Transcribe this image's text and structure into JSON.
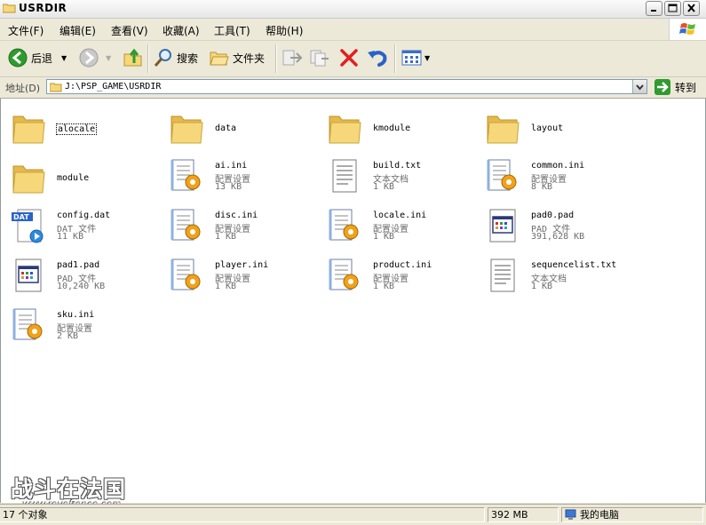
{
  "window": {
    "title": "USRDIR"
  },
  "menu": {
    "items": [
      "文件(F)",
      "编辑(E)",
      "查看(V)",
      "收藏(A)",
      "工具(T)",
      "帮助(H)"
    ]
  },
  "toolbar": {
    "back_label": "后退",
    "search_label": "搜索",
    "folders_label": "文件夹"
  },
  "address": {
    "label": "地址(D)",
    "value": "J:\\PSP_GAME\\USRDIR",
    "go_label": "转到"
  },
  "files": [
    {
      "name": "alocale",
      "kind": "folder",
      "icon": "folder-icon"
    },
    {
      "name": "data",
      "kind": "folder",
      "icon": "folder-icon"
    },
    {
      "name": "kmodule",
      "kind": "folder",
      "icon": "folder-icon"
    },
    {
      "name": "layout",
      "kind": "folder",
      "icon": "folder-icon"
    },
    {
      "name": "module",
      "kind": "folder",
      "icon": "folder-icon"
    },
    {
      "name": "ai.ini",
      "type": "配置设置",
      "size": "13 KB",
      "icon": "ini-file-icon"
    },
    {
      "name": "build.txt",
      "type": "文本文档",
      "size": "1 KB",
      "icon": "text-file-icon"
    },
    {
      "name": "common.ini",
      "type": "配置设置",
      "size": "8 KB",
      "icon": "ini-file-icon"
    },
    {
      "name": "config.dat",
      "type": "DAT 文件",
      "size": "11 KB",
      "icon": "dat-file-icon"
    },
    {
      "name": "disc.ini",
      "type": "配置设置",
      "size": "1 KB",
      "icon": "ini-file-icon"
    },
    {
      "name": "locale.ini",
      "type": "配置设置",
      "size": "1 KB",
      "icon": "ini-file-icon"
    },
    {
      "name": "pad0.pad",
      "type": "PAD 文件",
      "size": "391,628 KB",
      "icon": "pad-file-icon"
    },
    {
      "name": "pad1.pad",
      "type": "PAD 文件",
      "size": "10,240 KB",
      "icon": "pad-file-icon"
    },
    {
      "name": "player.ini",
      "type": "配置设置",
      "size": "1 KB",
      "icon": "ini-file-icon"
    },
    {
      "name": "product.ini",
      "type": "配置设置",
      "size": "1 KB",
      "icon": "ini-file-icon"
    },
    {
      "name": "sequencelist.txt",
      "type": "文本文档",
      "size": "1 KB",
      "icon": "text-file-icon"
    },
    {
      "name": "sku.ini",
      "type": "配置设置",
      "size": "2 KB",
      "icon": "ini-file-icon"
    }
  ],
  "status": {
    "count": "17 个对象",
    "size": "392 MB",
    "location": "我的电脑"
  },
  "watermark": {
    "big": "战斗在法国",
    "small": "www.revefrance.com"
  },
  "colors": {
    "folder": "#f6d77a",
    "back_arrow": "#2f9b2f",
    "delete": "#e02020",
    "undo": "#2a63c8"
  }
}
